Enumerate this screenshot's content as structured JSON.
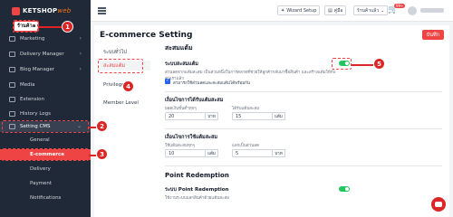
{
  "sidebar": {
    "logo_main": "KETSHOP",
    "logo_sub": "web",
    "store_label": "ร้านค้าa",
    "items": [
      {
        "label": "Marketing",
        "icon": "megaphone-icon"
      },
      {
        "label": "Delivery Manager",
        "icon": "truck-icon"
      },
      {
        "label": "Blog Manager",
        "icon": "blog-icon"
      },
      {
        "label": "Media",
        "icon": "image-icon"
      },
      {
        "label": "Extension",
        "icon": "puzzle-icon"
      },
      {
        "label": "History Logs",
        "icon": "history-icon"
      },
      {
        "label": "Setting CMS",
        "icon": "gear-icon"
      }
    ],
    "sub_items": [
      "General",
      "E-commerce",
      "Delivery",
      "Payment",
      "Notifications"
    ]
  },
  "topbar": {
    "wizard": "Wizard Setup",
    "manual": "คู่มือ",
    "store": "ร้านค้าแล้ว",
    "cart_badge": "99+"
  },
  "page": {
    "title": "E-commerce Setting",
    "save": "บันทึก",
    "tabs": [
      "ระบบทั่วไป",
      "สะสมแต้ม",
      "Privilege",
      "Member Level"
    ]
  },
  "points": {
    "section": "สะสมแต้ม",
    "system_label": "ระบบสะสมแต้ม",
    "desc": "ส่วนลดจากแต้มสะสม เป็นส่วนหนึ่งในการตลาดที่ช่วยให้ลูกค้ากลับมาซื้อสินค้า และสร้างแต้มให้กับคนเราแล้ว",
    "checkbox_label": "สามารถใช้ส่วนลดและสะสมแต้มได้พร้อมกัน",
    "earn_title": "เงื่อนไขการได้รับแต้มสะสม",
    "earn_amount_label": "ยอดเงินขั้นต่ำทุกๆ",
    "earn_amount": "20",
    "earn_amount_unit": "บาท",
    "earn_points_label": "ได้รับแต้มสะสม",
    "earn_points": "15",
    "earn_points_unit": "แต้ม",
    "use_title": "เงื่อนไขการใช้แต้มสะสม",
    "use_points_label": "ใช้แต้มสะสมทุกๆ",
    "use_points": "10",
    "use_points_unit": "แต้ม",
    "use_discount_label": "แลกเป็นส่วนลด",
    "use_discount": "5",
    "use_discount_unit": "บาท"
  },
  "redemption": {
    "section": "Point Redemption",
    "system_label": "ระบบ Point Redemption",
    "desc": "ใช้งานระบบแลกสินค้าด้วยแต้มสะสม"
  },
  "callouts": [
    "1",
    "2",
    "3",
    "4",
    "5"
  ],
  "colors": {
    "accent": "#ef4444",
    "sidebar": "#1f2937",
    "toggle_on": "#22c55e"
  }
}
